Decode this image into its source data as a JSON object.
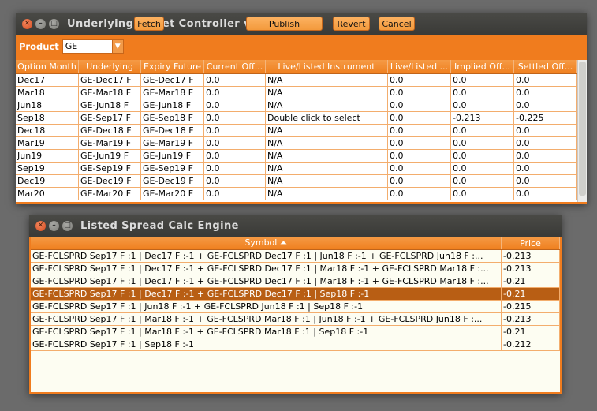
{
  "offset_window": {
    "title": "Underlying Offset Controller v0.8",
    "product_label": "Product",
    "product_value": "GE",
    "buttons": {
      "fetch": "Fetch",
      "publish": "Publish",
      "revert": "Revert",
      "cancel": "Cancel"
    },
    "columns": [
      "Option Month",
      "Underlying",
      "Expiry Future",
      "Current Off...",
      "Live/Listed Instrument",
      "Live/Listed ...",
      "Implied Off...",
      "Settled Off..."
    ],
    "rows": [
      [
        "Dec17",
        "GE-Dec17 F",
        "GE-Dec17 F",
        "0.0",
        "N/A",
        "0.0",
        "0.0",
        "0.0"
      ],
      [
        "Mar18",
        "GE-Mar18 F",
        "GE-Mar18 F",
        "0.0",
        "N/A",
        "0.0",
        "0.0",
        "0.0"
      ],
      [
        "Jun18",
        "GE-Jun18 F",
        "GE-Jun18 F",
        "0.0",
        "N/A",
        "0.0",
        "0.0",
        "0.0"
      ],
      [
        "Sep18",
        "GE-Sep17 F",
        "GE-Sep18 F",
        "0.0",
        "Double click to select",
        "0.0",
        "-0.213",
        "-0.225"
      ],
      [
        "Dec18",
        "GE-Dec18 F",
        "GE-Dec18 F",
        "0.0",
        "N/A",
        "0.0",
        "0.0",
        "0.0"
      ],
      [
        "Mar19",
        "GE-Mar19 F",
        "GE-Mar19 F",
        "0.0",
        "N/A",
        "0.0",
        "0.0",
        "0.0"
      ],
      [
        "Jun19",
        "GE-Jun19 F",
        "GE-Jun19 F",
        "0.0",
        "N/A",
        "0.0",
        "0.0",
        "0.0"
      ],
      [
        "Sep19",
        "GE-Sep19 F",
        "GE-Sep19 F",
        "0.0",
        "N/A",
        "0.0",
        "0.0",
        "0.0"
      ],
      [
        "Dec19",
        "GE-Dec19 F",
        "GE-Dec19 F",
        "0.0",
        "N/A",
        "0.0",
        "0.0",
        "0.0"
      ],
      [
        "Mar20",
        "GE-Mar20 F",
        "GE-Mar20 F",
        "0.0",
        "N/A",
        "0.0",
        "0.0",
        "0.0"
      ]
    ]
  },
  "spread_window": {
    "title": "Listed Spread Calc Engine",
    "columns": [
      "Symbol ⏶",
      "Price"
    ],
    "selected_row": 3,
    "rows": [
      [
        "GE-FCLSPRD Sep17 F :1 | Dec17 F :-1  + GE-FCLSPRD Dec17 F :1 | Jun18 F :-1  + GE-FCLSPRD Jun18 F :...",
        "-0.213"
      ],
      [
        "GE-FCLSPRD Sep17 F :1 | Dec17 F :-1  + GE-FCLSPRD Dec17 F :1 | Mar18 F :-1  + GE-FCLSPRD Mar18 F :...",
        "-0.213"
      ],
      [
        "GE-FCLSPRD Sep17 F :1 | Dec17 F :-1  + GE-FCLSPRD Dec17 F :1 | Mar18 F :-1  + GE-FCLSPRD Mar18 F :...",
        "-0.21"
      ],
      [
        "GE-FCLSPRD Sep17 F :1 | Dec17 F :-1  + GE-FCLSPRD Dec17 F :1 | Sep18 F :-1",
        "-0.21"
      ],
      [
        "GE-FCLSPRD Sep17 F :1 | Jun18 F :-1  + GE-FCLSPRD Jun18 F :1 | Sep18 F :-1",
        "-0.215"
      ],
      [
        "GE-FCLSPRD Sep17 F :1 | Mar18 F :-1  + GE-FCLSPRD Mar18 F :1 | Jun18 F :-1  + GE-FCLSPRD Jun18 F :...",
        "-0.213"
      ],
      [
        "GE-FCLSPRD Sep17 F :1 | Mar18 F :-1  + GE-FCLSPRD Mar18 F :1 | Sep18 F :-1",
        "-0.21"
      ],
      [
        "GE-FCLSPRD Sep17 F :1 | Sep18 F :-1",
        "-0.212"
      ]
    ]
  },
  "colors": {
    "accent": "#f07c1e",
    "selected_row": "#b85e14",
    "titlebar": "#3c3c3a",
    "desktop": "#6b6b6b"
  }
}
